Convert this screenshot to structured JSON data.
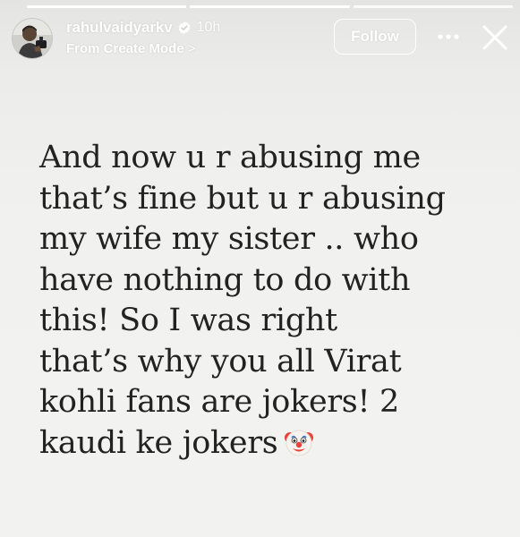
{
  "story": {
    "progress": [
      {
        "fill": 1.0
      },
      {
        "fill": 1.0
      },
      {
        "fill": 0.0
      }
    ]
  },
  "header": {
    "username": "rahulvaidyarkv",
    "verified_icon": "verified-badge-icon",
    "time": "10h",
    "source": "From Create Mode",
    "source_chevron": ">",
    "follow_label": "Follow",
    "more_icon": "more-options-icon",
    "close_icon": "close-icon"
  },
  "content": {
    "line1": "And now u r abusing me",
    "line2": "that’s fine but u r abusing",
    "line3": "my wife my sister .. who",
    "line4": "have nothing to do with",
    "line5": "this! So I was right",
    "line6": "that’s why you all Virat",
    "line7": "kohli fans are jokers! 2",
    "line8": "kaudi ke jokers",
    "emoji_icon": "clown-face-icon"
  },
  "colors": {
    "background": "#f1f1ef",
    "text": "#222222",
    "overlay_text": "#ffffff",
    "verified_badge": "#ffffff"
  }
}
